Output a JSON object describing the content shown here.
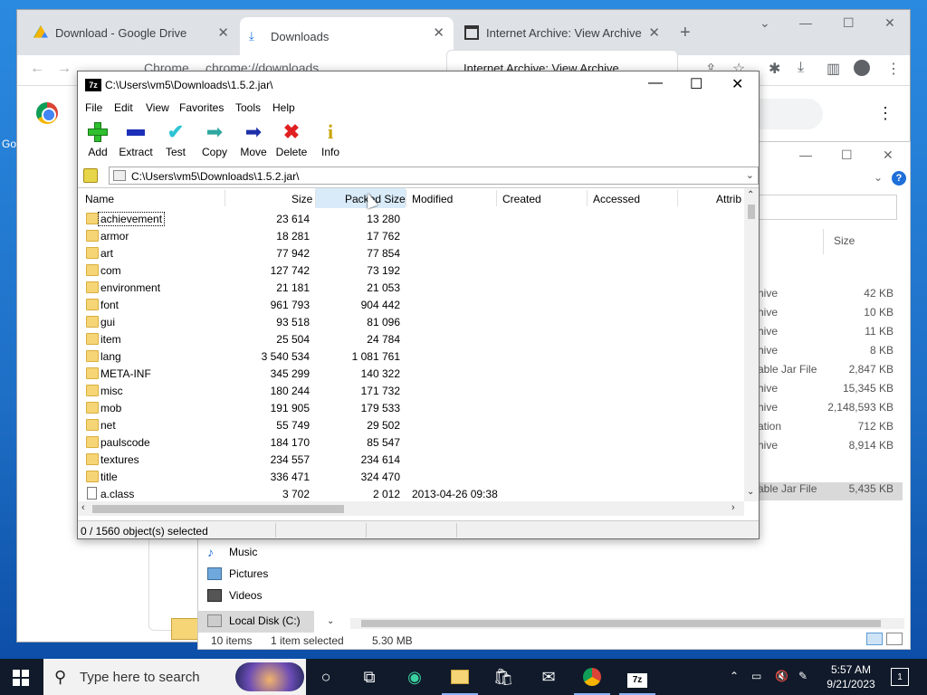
{
  "desktop": {
    "label": "Go"
  },
  "chrome": {
    "tabs": [
      {
        "title": "Download - Google Drive"
      },
      {
        "title": "Downloads"
      },
      {
        "title": "Internet Archive: View Archive"
      }
    ],
    "omnibox_site": "Chrome",
    "omnibox_url": "chrome://downloads",
    "popup_title": "Internet Archive: View Archive"
  },
  "explorer": {
    "size_header": "Size",
    "rows": [
      {
        "type": "hive",
        "size": "42 KB"
      },
      {
        "type": "hive",
        "size": "10 KB"
      },
      {
        "type": "hive",
        "size": "11 KB"
      },
      {
        "type": "hive",
        "size": "8 KB"
      },
      {
        "type": "able Jar File",
        "size": "2,847 KB"
      },
      {
        "type": "hive",
        "size": "15,345 KB"
      },
      {
        "type": "hive",
        "size": "2,148,593 KB"
      },
      {
        "type": "ation",
        "size": "712 KB"
      },
      {
        "type": "hive",
        "size": "8,914 KB"
      }
    ],
    "selected_row": {
      "type": "able Jar File",
      "size": "5,435 KB"
    },
    "nav": [
      "Music",
      "Pictures",
      "Videos",
      "Local Disk (C:)"
    ],
    "status": {
      "items": "10 items",
      "selected": "1 item selected",
      "size": "5.30 MB"
    }
  },
  "sevenzip": {
    "title": "C:\\Users\\vm5\\Downloads\\1.5.2.jar\\",
    "menu": [
      "File",
      "Edit",
      "View",
      "Favorites",
      "Tools",
      "Help"
    ],
    "toolbar": [
      "Add",
      "Extract",
      "Test",
      "Copy",
      "Move",
      "Delete",
      "Info"
    ],
    "address": "C:\\Users\\vm5\\Downloads\\1.5.2.jar\\",
    "columns": [
      "Name",
      "Size",
      "Packed Size",
      "Modified",
      "Created",
      "Accessed",
      "Attrib"
    ],
    "rows": [
      {
        "name": "achievement",
        "size": "23 614",
        "packed": "13 280",
        "modified": "",
        "kind": "folder"
      },
      {
        "name": "armor",
        "size": "18 281",
        "packed": "17 762",
        "modified": "",
        "kind": "folder"
      },
      {
        "name": "art",
        "size": "77 942",
        "packed": "77 854",
        "modified": "",
        "kind": "folder"
      },
      {
        "name": "com",
        "size": "127 742",
        "packed": "73 192",
        "modified": "",
        "kind": "folder"
      },
      {
        "name": "environment",
        "size": "21 181",
        "packed": "21 053",
        "modified": "",
        "kind": "folder"
      },
      {
        "name": "font",
        "size": "961 793",
        "packed": "904 442",
        "modified": "",
        "kind": "folder"
      },
      {
        "name": "gui",
        "size": "93 518",
        "packed": "81 096",
        "modified": "",
        "kind": "folder"
      },
      {
        "name": "item",
        "size": "25 504",
        "packed": "24 784",
        "modified": "",
        "kind": "folder"
      },
      {
        "name": "lang",
        "size": "3 540 534",
        "packed": "1 081 761",
        "modified": "",
        "kind": "folder"
      },
      {
        "name": "META-INF",
        "size": "345 299",
        "packed": "140 322",
        "modified": "",
        "kind": "folder"
      },
      {
        "name": "misc",
        "size": "180 244",
        "packed": "171 732",
        "modified": "",
        "kind": "folder"
      },
      {
        "name": "mob",
        "size": "191 905",
        "packed": "179 533",
        "modified": "",
        "kind": "folder"
      },
      {
        "name": "net",
        "size": "55 749",
        "packed": "29 502",
        "modified": "",
        "kind": "folder"
      },
      {
        "name": "paulscode",
        "size": "184 170",
        "packed": "85 547",
        "modified": "",
        "kind": "folder"
      },
      {
        "name": "textures",
        "size": "234 557",
        "packed": "234 614",
        "modified": "",
        "kind": "folder"
      },
      {
        "name": "title",
        "size": "336 471",
        "packed": "324 470",
        "modified": "",
        "kind": "folder"
      },
      {
        "name": "a.class",
        "size": "3 702",
        "packed": "2 012",
        "modified": "2013-04-26 09:38",
        "kind": "file"
      }
    ],
    "status": "0 / 1560 object(s) selected"
  },
  "taskbar": {
    "search_placeholder": "Type here to search",
    "time": "5:57 AM",
    "date": "9/21/2023",
    "notifications": "1"
  }
}
